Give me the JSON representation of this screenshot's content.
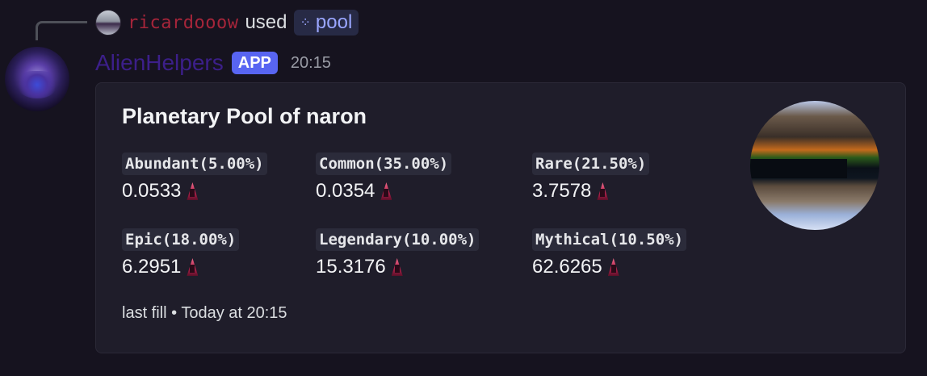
{
  "interaction": {
    "username": "ricardooow",
    "used_text": "used",
    "command": "pool"
  },
  "message": {
    "bot_name": "AlienHelpers",
    "badge": "APP",
    "time": "20:15"
  },
  "embed": {
    "title": "Planetary Pool of naron",
    "fields": [
      {
        "label": "Abundant(5.00%)",
        "value": "0.0533"
      },
      {
        "label": "Common(35.00%)",
        "value": "0.0354"
      },
      {
        "label": "Rare(21.50%)",
        "value": "3.7578"
      },
      {
        "label": "Epic(18.00%)",
        "value": "6.2951"
      },
      {
        "label": "Legendary(10.00%)",
        "value": "15.3176"
      },
      {
        "label": "Mythical(10.50%)",
        "value": "62.6265"
      }
    ],
    "footer": "last fill • Today at 20:15"
  },
  "icons": {
    "currency": "rocket-coin-icon",
    "command": "slash-command-icon"
  },
  "colors": {
    "background": "#16131f",
    "embed_bg": "#1f1d2a",
    "username": "#a6253a",
    "bot_name": "#3c1f8a",
    "app_badge": "#5865f2",
    "command_chip_text": "#9aa6ff"
  }
}
